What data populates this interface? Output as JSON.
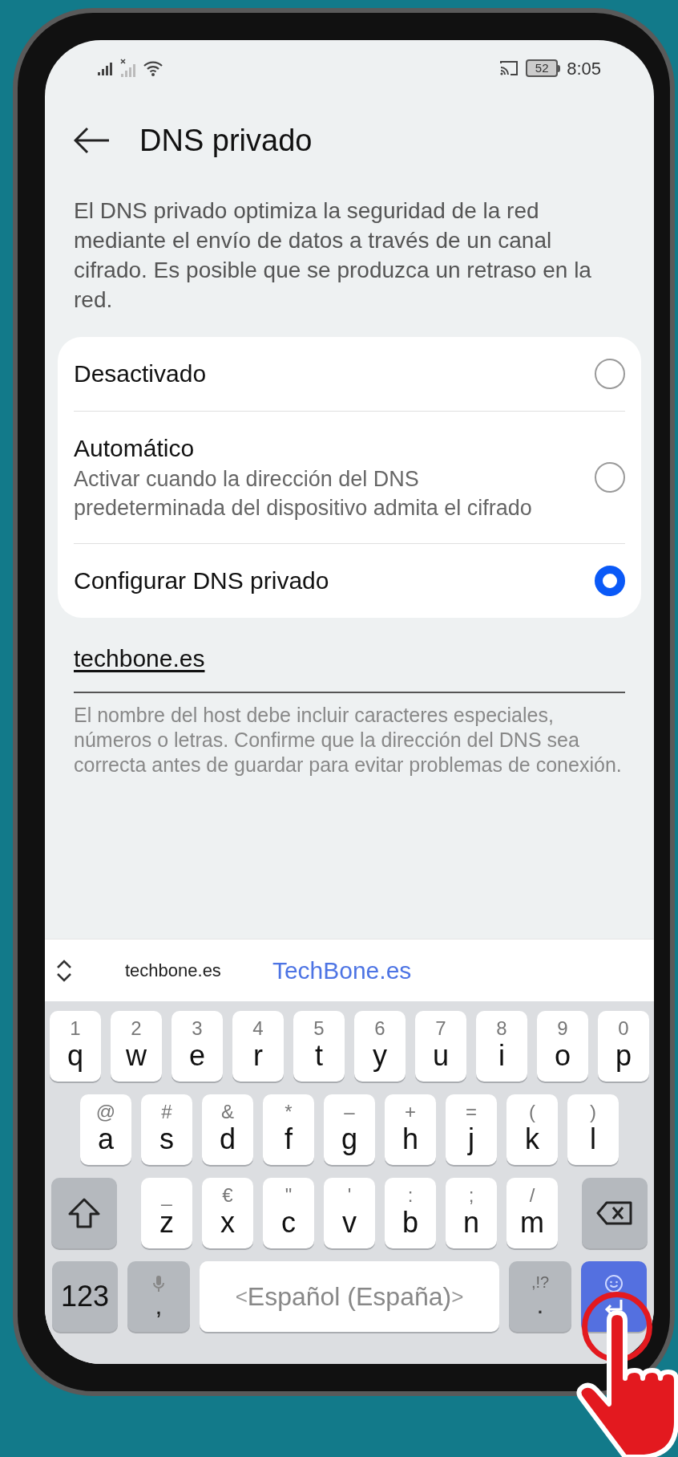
{
  "status_bar": {
    "time": "8:05",
    "battery": "52"
  },
  "header": {
    "title": "DNS privado"
  },
  "description": "El DNS privado optimiza la seguridad de la red mediante el envío de datos a través de un canal cifrado. Es posible que se produzca un retraso en la red.",
  "options": [
    {
      "label": "Desactivado",
      "selected": false
    },
    {
      "label": "Automático",
      "subtitle": "Activar cuando la dirección del DNS predeterminada del dispositivo admita el cifrado",
      "selected": false
    },
    {
      "label": "Configurar DNS privado",
      "selected": true
    }
  ],
  "hostname_field": {
    "value": "techbone.es"
  },
  "helper_text": "El nombre del host debe incluir caracteres especiales, números o letras. Confirme que la dirección del DNS sea correcta antes de guardar para evitar problemas de conexión.",
  "suggestions": [
    "techbone.es",
    "TechBone.es"
  ],
  "keyboard": {
    "letter_rows": [
      [
        {
          "kind": "letter",
          "label": "q",
          "hint": "1"
        },
        {
          "kind": "letter",
          "label": "w",
          "hint": "2"
        },
        {
          "kind": "letter",
          "label": "e",
          "hint": "3"
        },
        {
          "kind": "letter",
          "label": "r",
          "hint": "4"
        },
        {
          "kind": "letter",
          "label": "t",
          "hint": "5"
        },
        {
          "kind": "letter",
          "label": "y",
          "hint": "6"
        },
        {
          "kind": "letter",
          "label": "u",
          "hint": "7"
        },
        {
          "kind": "letter",
          "label": "i",
          "hint": "8"
        },
        {
          "kind": "letter",
          "label": "o",
          "hint": "9"
        },
        {
          "kind": "letter",
          "label": "p",
          "hint": "0"
        }
      ],
      [
        {
          "kind": "letter",
          "label": "a",
          "hint": "@"
        },
        {
          "kind": "letter",
          "label": "s",
          "hint": "#"
        },
        {
          "kind": "letter",
          "label": "d",
          "hint": "&"
        },
        {
          "kind": "letter",
          "label": "f",
          "hint": "*"
        },
        {
          "kind": "letter",
          "label": "g",
          "hint": "–"
        },
        {
          "kind": "letter",
          "label": "h",
          "hint": "+"
        },
        {
          "kind": "letter",
          "label": "j",
          "hint": "="
        },
        {
          "kind": "letter",
          "label": "k",
          "hint": "("
        },
        {
          "kind": "letter",
          "label": "l",
          "hint": ")"
        }
      ],
      [
        {
          "kind": "shift"
        },
        {
          "kind": "letter",
          "label": "z",
          "hint": "_"
        },
        {
          "kind": "letter",
          "label": "x",
          "hint": "€"
        },
        {
          "kind": "letter",
          "label": "c",
          "hint": "\""
        },
        {
          "kind": "letter",
          "label": "v",
          "hint": "'"
        },
        {
          "kind": "letter",
          "label": "b",
          "hint": ":"
        },
        {
          "kind": "letter",
          "label": "n",
          "hint": ";"
        },
        {
          "kind": "letter",
          "label": "m",
          "hint": "/"
        },
        {
          "kind": "backspace"
        }
      ]
    ],
    "bottom_row": [
      {
        "kind": "mode",
        "label": "123"
      },
      {
        "kind": "mic",
        "label": ","
      },
      {
        "kind": "space",
        "label": "Español (España)",
        "left": "<",
        "right": ">"
      },
      {
        "kind": "punct",
        "label": ".",
        "hint": ",!?"
      },
      {
        "kind": "enter"
      }
    ]
  }
}
